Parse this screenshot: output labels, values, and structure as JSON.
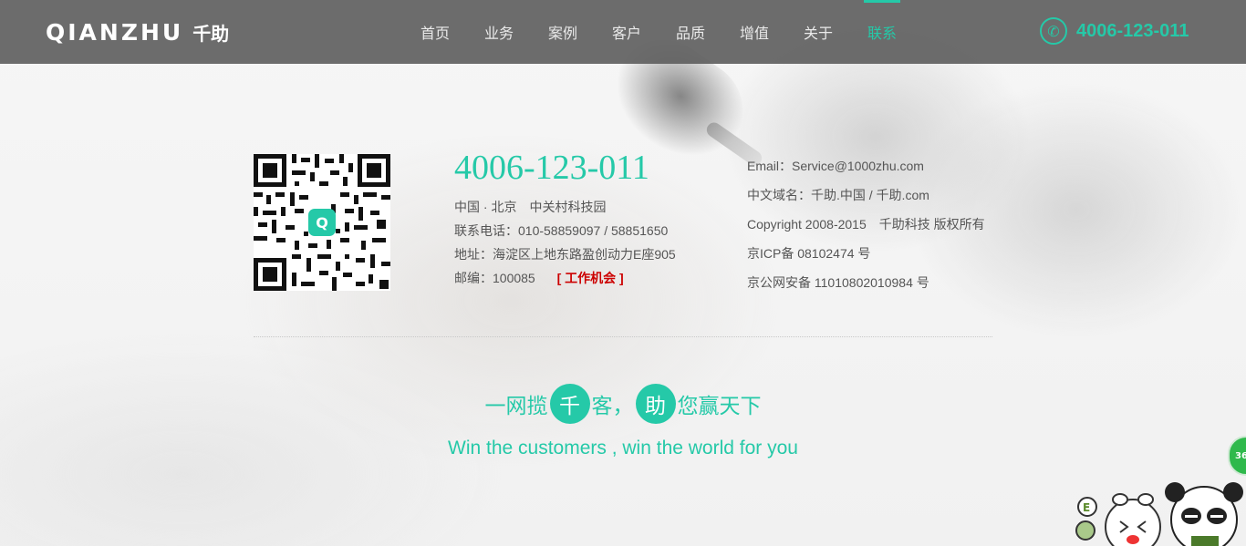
{
  "header": {
    "logo_latin": "QIANZHU",
    "logo_cn": "千助",
    "nav": [
      "首页",
      "业务",
      "案例",
      "客户",
      "品质",
      "增值",
      "关于",
      "联系"
    ],
    "active_index": 7,
    "phone": "4006-123-011"
  },
  "contact": {
    "phone": "4006-123-011",
    "location": "中国 · 北京　中关村科技园",
    "tel": "联系电话：010-58859097 / 58851650",
    "address": "地址：海淀区上地东路盈创动力E座905",
    "postcode": "邮编：100085",
    "jobs_link": "[ 工作机会 ]"
  },
  "info": {
    "email": "Email：Service@1000zhu.com",
    "domain": "中文域名：千助.中国 / 千助.com",
    "copyright": "Copyright 2008-2015　千助科技 版权所有",
    "icp": "京ICP备 08102474 号",
    "police": "京公网安备 11010802010984 号"
  },
  "slogan": {
    "part1": "一网揽",
    "circle1": "千",
    "part2": "客，",
    "circle2": "助",
    "part3": "您赢天下",
    "english": "Win the customers , win the world for you"
  },
  "badge": {
    "text": "36"
  },
  "colors": {
    "accent": "#25c9a8",
    "header_bg": "#5f5f5f",
    "job_link": "#cc0000"
  }
}
